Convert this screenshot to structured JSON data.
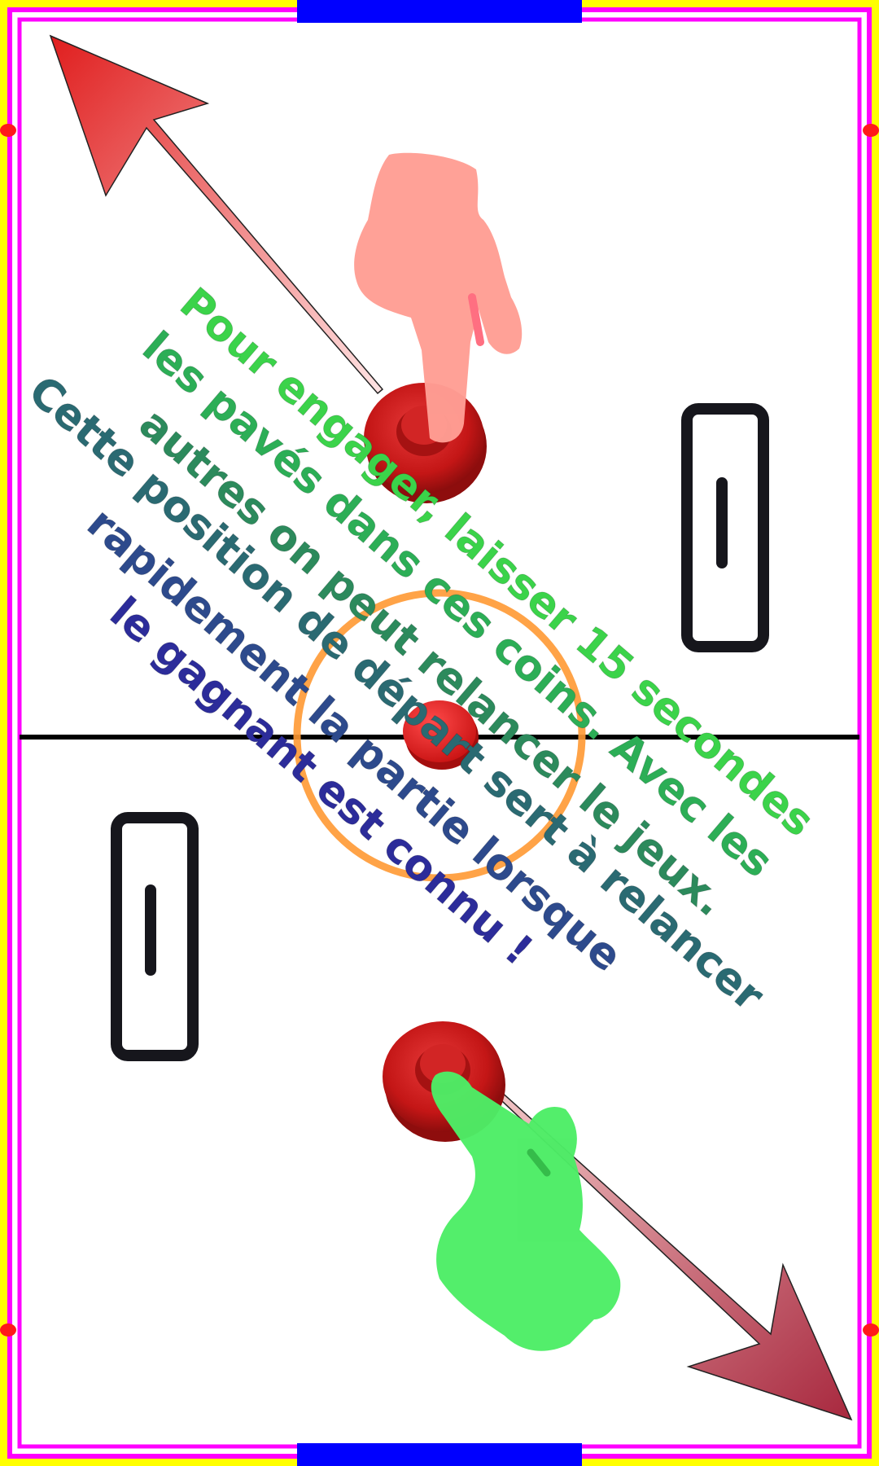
{
  "instruction": {
    "lines": [
      "Pour engager, laisser 15 secondes",
      "les pavés dans ces coins. Avec les",
      "autres on peut relancer le jeux.",
      "Cette position de départ sert à relancer",
      "rapidement la partie lorsque",
      "le gagnant est connu !"
    ],
    "line_colors": [
      "#3bd34a",
      "#2cae56",
      "#2c8a5c",
      "#2a6a72",
      "#2d4a8c",
      "#2c2c9a"
    ]
  },
  "colors": {
    "outer_border": "#ffff00",
    "rink_border": "#ff00ff",
    "goal": "#0000ff",
    "center_line": "#000000",
    "center_circle": "#ff9933",
    "mallet": "#cc1a1a",
    "top_hand": "#ff9e94",
    "bottom_hand": "#4ded66",
    "arrow": "#e26a6a",
    "score_box": "#16161c"
  },
  "scores": {
    "top": 1,
    "bottom": 1
  },
  "icons": {
    "top_hand": "pointing-hand-icon",
    "bottom_hand": "pointing-hand-icon",
    "arrows": "diagonal-arrow-icon"
  }
}
